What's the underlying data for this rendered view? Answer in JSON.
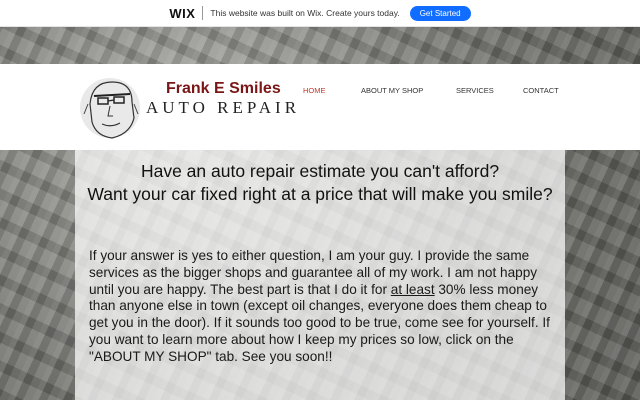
{
  "wix_banner": {
    "logo": "WIX",
    "message": "This website was built on Wix. Create yours today.",
    "cta_label": "Get Started",
    "cta_color": "#116dff"
  },
  "brand": {
    "name": "Frank E Smiles",
    "subtitle": "AUTO REPAIR",
    "name_color": "#7a1616",
    "logo_icon": "sketched-face-icon"
  },
  "nav": {
    "items": [
      {
        "label": "HOME",
        "active": true
      },
      {
        "label": "ABOUT MY SHOP",
        "active": false
      },
      {
        "label": "SERVICES",
        "active": false
      },
      {
        "label": "CONTACT",
        "active": false
      }
    ],
    "active_color": "#c0392b"
  },
  "main": {
    "headline_line1": "Have an auto repair estimate you can't afford?",
    "headline_line2": "Want your car fixed right at a price that will make you smile?",
    "paragraph_before": "If your answer is yes to either question, I am your guy.  I provide the same services as the bigger shops and guarantee all of my work.  I am not happy until you are happy.  The best part is that I do it for ",
    "paragraph_underlined": "at least",
    "paragraph_after": " 30% less money than anyone else in town (except oil changes, everyone does them cheap to get you in the door).  If it sounds too good to be true, come see for yourself.  If you want to learn more about how I keep my prices so low, click on the \"ABOUT MY SHOP\" tab.  See you soon!!"
  }
}
